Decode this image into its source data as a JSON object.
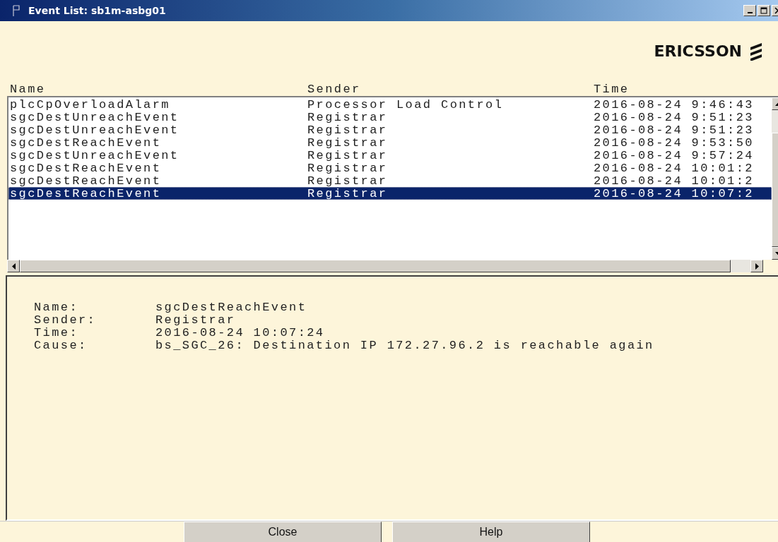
{
  "window": {
    "title": "Event List: sb1m-asbg01"
  },
  "logo": {
    "text": "ERICSSON"
  },
  "table": {
    "columns": [
      "Name",
      "Sender",
      "Time"
    ],
    "rows": [
      {
        "cells": [
          "plcCpOverloadAlarm",
          "Processor Load Control",
          "2016-08-24 9:46:43"
        ],
        "selected": false
      },
      {
        "cells": [
          "sgcDestUnreachEvent",
          "Registrar",
          "2016-08-24 9:51:23"
        ],
        "selected": false
      },
      {
        "cells": [
          "sgcDestUnreachEvent",
          "Registrar",
          "2016-08-24 9:51:23"
        ],
        "selected": false
      },
      {
        "cells": [
          "sgcDestReachEvent",
          "Registrar",
          "2016-08-24 9:53:50"
        ],
        "selected": false
      },
      {
        "cells": [
          "sgcDestUnreachEvent",
          "Registrar",
          "2016-08-24 9:57:24"
        ],
        "selected": false
      },
      {
        "cells": [
          "sgcDestReachEvent",
          "Registrar",
          "2016-08-24 10:01:2"
        ],
        "selected": false
      },
      {
        "cells": [
          "sgcDestReachEvent",
          "Registrar",
          "2016-08-24 10:01:2"
        ],
        "selected": false
      },
      {
        "cells": [
          "sgcDestReachEvent",
          "Registrar",
          "2016-08-24 10:07:2"
        ],
        "selected": true
      }
    ]
  },
  "details": [
    {
      "label": "Name:",
      "value": "sgcDestReachEvent"
    },
    {
      "label": "Sender:",
      "value": "Registrar"
    },
    {
      "label": "Time:",
      "value": "2016-08-24 10:07:24"
    },
    {
      "label": "Cause:",
      "value": "bs_SGC_26: Destination IP 172.27.96.2 is reachable again"
    }
  ],
  "buttons": [
    "Close",
    "Help"
  ]
}
